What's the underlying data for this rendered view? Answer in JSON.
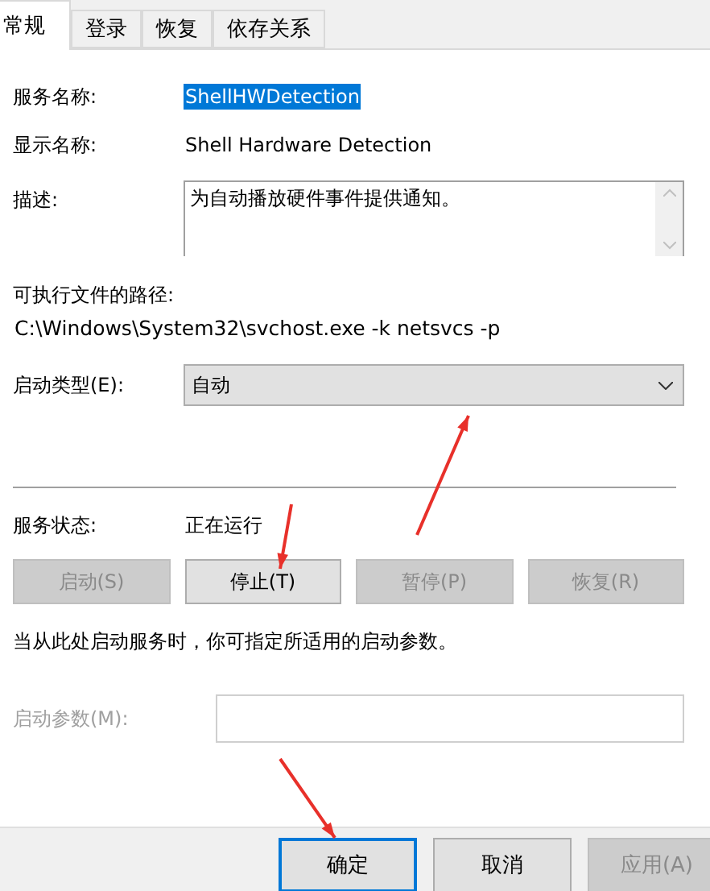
{
  "tabs": [
    {
      "label": "常规",
      "selected": true
    },
    {
      "label": "登录",
      "selected": false
    },
    {
      "label": "恢复",
      "selected": false
    },
    {
      "label": "依存关系",
      "selected": false
    }
  ],
  "service_name": {
    "label": "服务名称:",
    "value": "ShellHWDetection",
    "highlighted": true
  },
  "display_name": {
    "label": "显示名称:",
    "value": "Shell Hardware Detection"
  },
  "description": {
    "label": "描述:",
    "value": "为自动播放硬件事件提供通知。"
  },
  "executable_path": {
    "label": "可执行文件的路径:",
    "value": "C:\\Windows\\System32\\svchost.exe -k netsvcs -p"
  },
  "startup_type": {
    "label": "启动类型(E):",
    "value": "自动"
  },
  "service_status": {
    "label": "服务状态:",
    "value": "正在运行"
  },
  "service_buttons": [
    {
      "label": "启动(S)",
      "disabled": true
    },
    {
      "label": "停止(T)",
      "disabled": false
    },
    {
      "label": "暂停(P)",
      "disabled": true
    },
    {
      "label": "恢复(R)",
      "disabled": true
    }
  ],
  "note": "当从此处启动服务时，你可指定所适用的启动参数。",
  "start_parameters": {
    "label": "启动参数(M):",
    "disabled": true
  },
  "footer_buttons": [
    {
      "label": "确定",
      "default": true,
      "disabled": false
    },
    {
      "label": "取消",
      "default": false,
      "disabled": false
    },
    {
      "label": "应用(A)",
      "default": false,
      "disabled": true
    }
  ],
  "annotations": [
    {
      "kind": "arrow"
    },
    {
      "kind": "arrow"
    },
    {
      "kind": "arrow"
    }
  ]
}
